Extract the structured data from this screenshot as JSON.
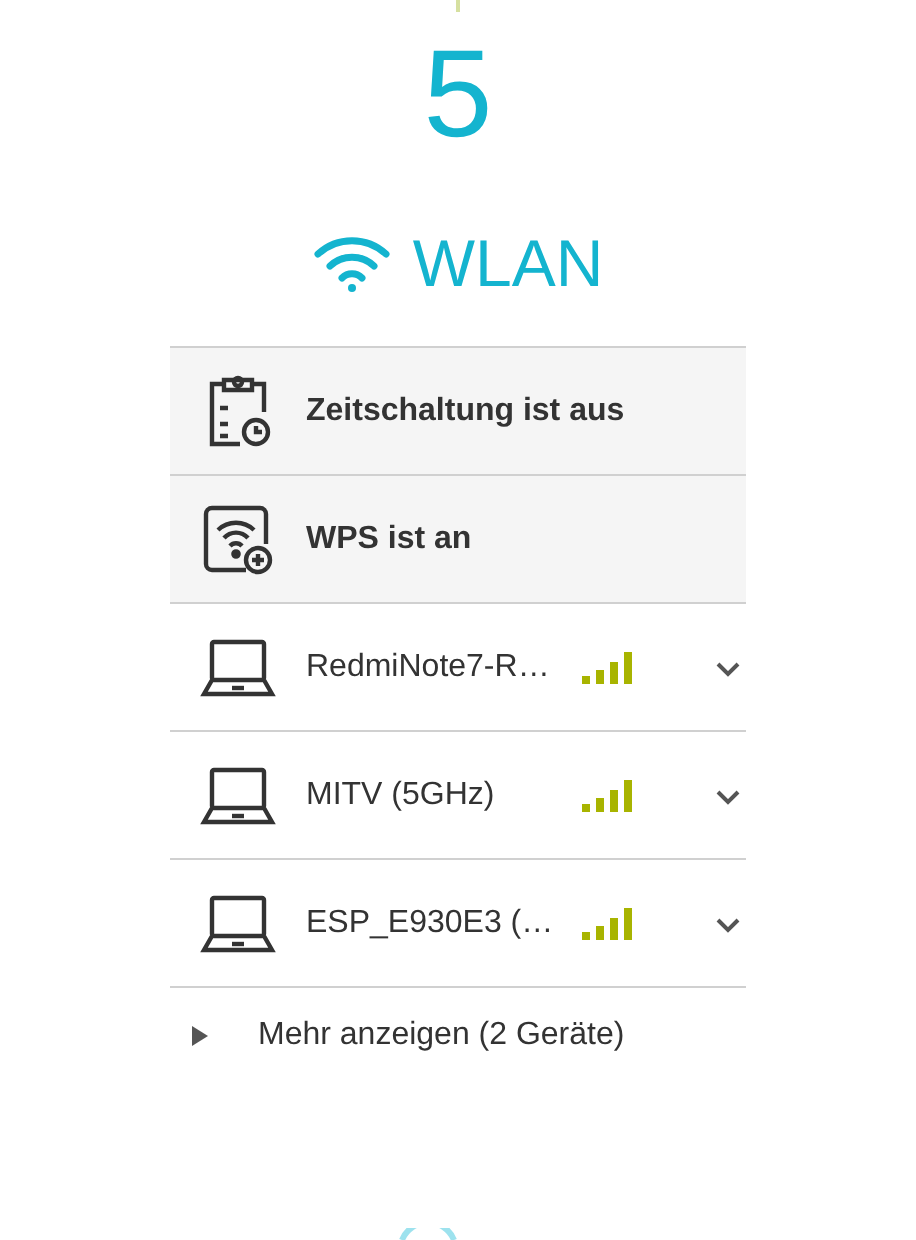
{
  "count": "5",
  "section": {
    "title": "WLAN"
  },
  "status_rows": [
    {
      "kind": "schedule",
      "label": "Zeitschaltung ist aus"
    },
    {
      "kind": "wps",
      "label": "WPS ist an"
    }
  ],
  "devices": [
    {
      "name": "RedmiNote7-R…",
      "expanded": false
    },
    {
      "name": "MITV (5GHz)",
      "expanded": false
    },
    {
      "name": "ESP_E930E3 (…",
      "expanded": false
    }
  ],
  "more": {
    "label": "Mehr anzeigen (2 Geräte)",
    "expanded": false
  }
}
